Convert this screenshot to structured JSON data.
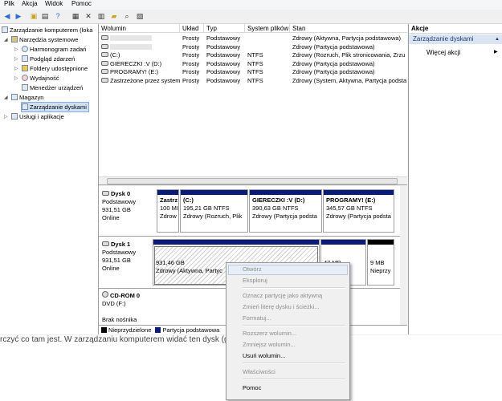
{
  "menu": [
    "Plik",
    "Akcja",
    "Widok",
    "Pomoc"
  ],
  "toolbar_icons": [
    "back-icon",
    "forward-icon",
    "folder-up-icon",
    "show-tree-icon",
    "help-icon",
    "properties-icon",
    "delete-icon",
    "properties-sheet-icon",
    "open-icon",
    "search-icon",
    "view-icon"
  ],
  "tree": {
    "root": "Zarządzanie komputerem (loka",
    "system_tools": "Narzędzia systemowe",
    "task_scheduler": "Harmonogram zadań",
    "event_viewer": "Podgląd zdarzeń",
    "shared_folders": "Foldery udostępnione",
    "performance": "Wydajność",
    "device_manager": "Menedżer urządzeń",
    "storage": "Magazyn",
    "disk_mgmt": "Zarządzanie dyskami",
    "services": "Usługi i aplikacje"
  },
  "columns": [
    "Wolumin",
    "Układ",
    "Typ",
    "System plików",
    "Stan"
  ],
  "volumes": [
    {
      "name": "",
      "layout": "Prosty",
      "type": "Podstawowy",
      "fs": "",
      "status": "Zdrowy (Aktywna, Partycja podstawowa)"
    },
    {
      "name": "",
      "layout": "Prosty",
      "type": "Podstawowy",
      "fs": "",
      "status": "Zdrowy (Partycja podstawowa)"
    },
    {
      "name": "(C:)",
      "layout": "Prosty",
      "type": "Podstawowy",
      "fs": "NTFS",
      "status": "Zdrowy (Rozruch, Plik stronicowania, Zrzu"
    },
    {
      "name": "GIERECZKI :V (D:)",
      "layout": "Prosty",
      "type": "Podstawowy",
      "fs": "NTFS",
      "status": "Zdrowy (Partycja podstawowa)"
    },
    {
      "name": "PROGRAMY! (E:)",
      "layout": "Prosty",
      "type": "Podstawowy",
      "fs": "NTFS",
      "status": "Zdrowy (Partycja podstawowa)"
    },
    {
      "name": "Zastrzeżone przez system",
      "layout": "Prosty",
      "type": "Podstawowy",
      "fs": "NTFS",
      "status": "Zdrowy (System, Aktywna, Partycja podsta"
    }
  ],
  "disk0": {
    "name": "Dysk 0",
    "type": "Podstawowy",
    "size": "931,51 GB",
    "state": "Online",
    "parts": [
      {
        "l1": "Zastrz",
        "l2": "100 MI",
        "l3": "Zdrow"
      },
      {
        "l1": "(C:)",
        "l2": "195,21 GB NTFS",
        "l3": "Zdrowy (Rozruch, Plik"
      },
      {
        "l1": "GIERECZKI :V  (D:)",
        "l2": "390,63 GB NTFS",
        "l3": "Zdrowy (Partycja podsta"
      },
      {
        "l1": "PROGRAMY!  (E:)",
        "l2": "345,57 GB NTFS",
        "l3": "Zdrowy (Partycja podsta"
      }
    ]
  },
  "disk1": {
    "name": "Dysk 1",
    "type": "Podstawowy",
    "size": "931,51 GB",
    "state": "Online",
    "parts": [
      {
        "l1": "931,46 GB",
        "l2": "Zdrowy (Aktywna, Partyc"
      },
      {
        "l1": "47 MB",
        "l2": ""
      },
      {
        "l1": "9 MB",
        "l2": "Nieprzy"
      }
    ]
  },
  "cdrom": {
    "name": "CD-ROM 0",
    "type": "DVD (F:)",
    "media": "Brak nośnika"
  },
  "legend": {
    "unallocated": "Nieprzydzielone",
    "primary": "Partycja podstawowa"
  },
  "actions": {
    "header": "Akcje",
    "section": "Zarządzanie dyskami",
    "more": "Więcej akcji"
  },
  "context_menu": [
    {
      "label": "Otwórz",
      "enabled": false
    },
    {
      "label": "Eksploruj",
      "enabled": false
    },
    {
      "label": "Oznacz partycję jako aktywną",
      "enabled": false
    },
    {
      "label": "Zmień literę dysku i ścieżki...",
      "enabled": false
    },
    {
      "label": "Formatuj...",
      "enabled": false
    },
    {
      "label": "Rozszerz wolumin...",
      "enabled": false
    },
    {
      "label": "Zmniejsz wolumin...",
      "enabled": false
    },
    {
      "label": "Usuń wolumin...",
      "enabled": true
    },
    {
      "label": "Właściwości",
      "enabled": false
    },
    {
      "label": "Pomoc",
      "enabled": true
    }
  ],
  "bottom_text": "rczyć co tam jest. W zarządzaniu komputerem widać ten dysk (gra",
  "colors": {
    "primary_partition": "#0a1a7a",
    "unallocated": "#000000",
    "selection": "#cfe0f5"
  }
}
